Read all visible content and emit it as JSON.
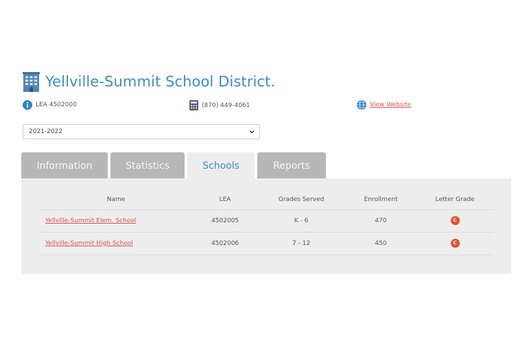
{
  "district": {
    "title": "Yellville-Summit School District.",
    "lea": "LEA 4502000",
    "phone": "(870) 449-4061",
    "website_label": "View Website"
  },
  "year_select": {
    "selected": "2021-2022"
  },
  "tabs": [
    {
      "label": "Information",
      "active": false
    },
    {
      "label": "Statistics",
      "active": false
    },
    {
      "label": "Schools",
      "active": true
    },
    {
      "label": "Reports",
      "active": false
    }
  ],
  "schools_table": {
    "headers": [
      "Name",
      "LEA",
      "Grades Served",
      "Enrollment",
      "Letter Grade"
    ],
    "rows": [
      {
        "name": "Yellville-Summit Elem. School",
        "lea": "4502005",
        "grades": "K - 6",
        "enrollment": "470",
        "letter_grade": "C"
      },
      {
        "name": "Yellville-Summit High School",
        "lea": "4502006",
        "grades": "7 - 12",
        "enrollment": "450",
        "letter_grade": "C"
      }
    ]
  },
  "colors": {
    "accent_blue": "#3b8fc9",
    "link_red": "#d9534f",
    "tab_inactive": "#b7b7b7",
    "panel_bg": "#ededed",
    "grade_badge": "#e0522e"
  },
  "icons": {
    "title": "school-building-icon",
    "lea": "info-icon",
    "phone": "phone-icon",
    "website": "globe-icon"
  }
}
